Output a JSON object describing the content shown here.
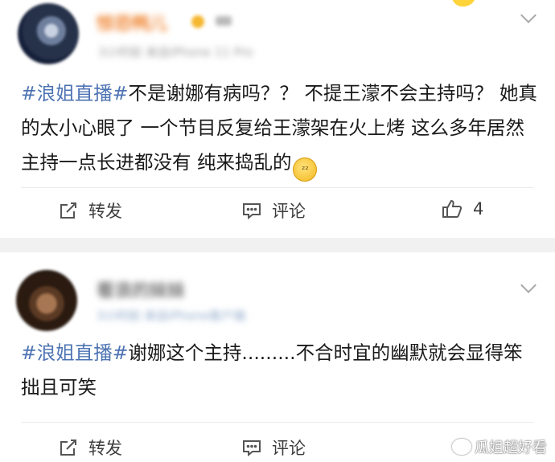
{
  "posts": [
    {
      "username": "惊恐鸭儿",
      "meta": "3小时前  来自iPhone 11 Pro",
      "hashtag": "#浪姐直播#",
      "text": "不是谢娜有病吗？？ 不提王濛不会主持吗？ 她真的太小心眼了 一个节目反复给王濛架在火上烤 这么多年居然主持一点长进都没有 纯来捣乱的",
      "emoji": "zzz-face-emoji",
      "actions": {
        "repost": "转发",
        "comment": "评论",
        "like": "4"
      }
    },
    {
      "username": "看浪的妹妹",
      "meta": "3小时前  来自iPhone客户端",
      "hashtag": "#浪姐直播#",
      "text": "谢娜这个主持.........不合时宜的幽默就会显得笨拙且可笑",
      "actions": {
        "repost": "转发",
        "comment": "评论"
      }
    }
  ],
  "watermark": "瓜姐超好看",
  "colors": {
    "hashtag": "#4d73b3",
    "separator": "#f1f1f1"
  }
}
